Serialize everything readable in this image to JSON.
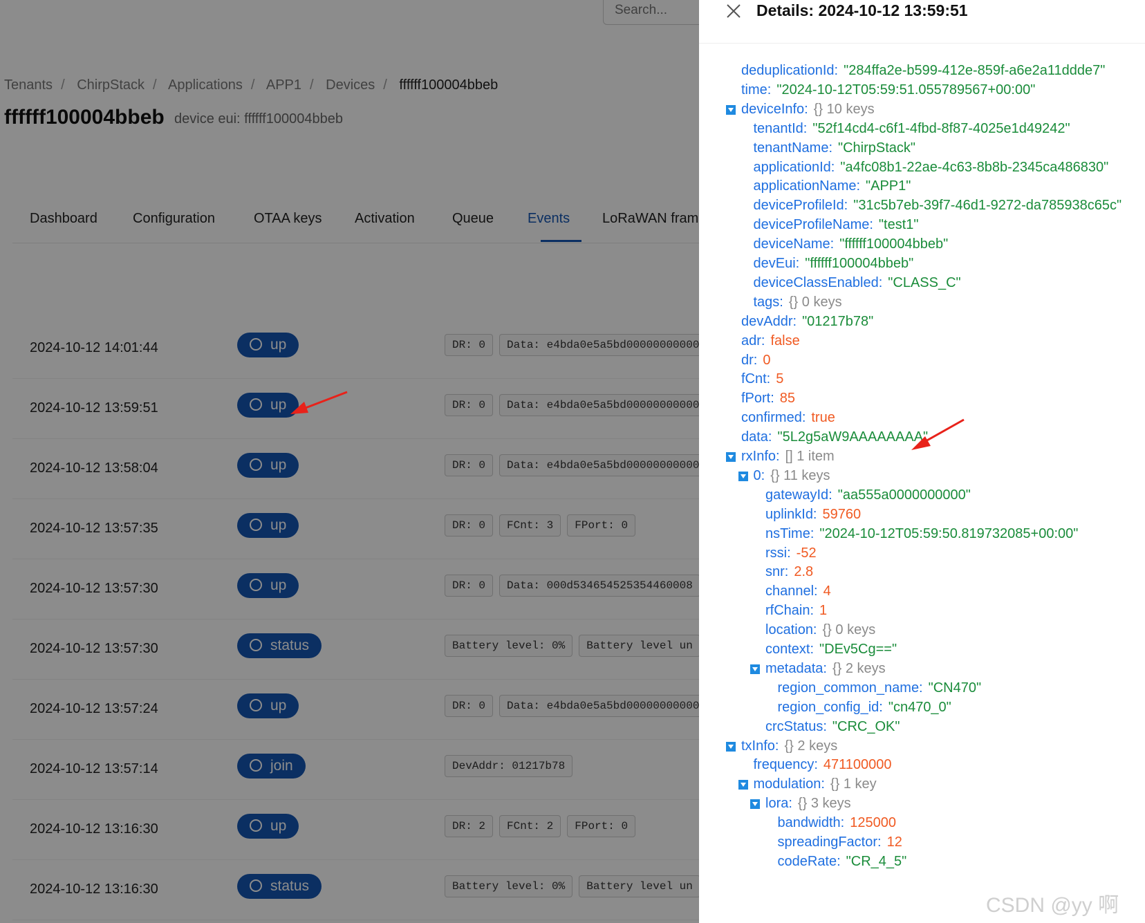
{
  "header": {
    "search_placeholder": "Search..."
  },
  "breadcrumb": [
    "Tenants",
    "ChirpStack",
    "Applications",
    "APP1",
    "Devices",
    "ffffff100004bbeb"
  ],
  "breadcrumb_sep": "/",
  "page_title": "ffffff100004bbeb",
  "page_subtitle": "device eui: ffffff100004bbeb",
  "tabs": [
    "Dashboard",
    "Configuration",
    "OTAA keys",
    "Activation",
    "Queue",
    "Events",
    "LoRaWAN fram"
  ],
  "active_tab": "Events",
  "events": [
    {
      "time": "2024-10-12 14:01:44",
      "type": "up",
      "tags": [
        "DR: 0",
        "Data: e4bda0e5a5bd00000000000"
      ]
    },
    {
      "time": "2024-10-12 13:59:51",
      "type": "up",
      "tags": [
        "DR: 0",
        "Data: e4bda0e5a5bd00000000000"
      ]
    },
    {
      "time": "2024-10-12 13:58:04",
      "type": "up",
      "tags": [
        "DR: 0",
        "Data: e4bda0e5a5bd00000000000"
      ]
    },
    {
      "time": "2024-10-12 13:57:35",
      "type": "up",
      "tags": [
        "DR: 0",
        "FCnt: 3",
        "FPort: 0"
      ]
    },
    {
      "time": "2024-10-12 13:57:30",
      "type": "up",
      "tags": [
        "DR: 0",
        "Data: 000d534654525354460008"
      ]
    },
    {
      "time": "2024-10-12 13:57:30",
      "type": "status",
      "tags": [
        "Battery level: 0%",
        "Battery level un"
      ]
    },
    {
      "time": "2024-10-12 13:57:24",
      "type": "up",
      "tags": [
        "DR: 0",
        "Data: e4bda0e5a5bd00000000000"
      ]
    },
    {
      "time": "2024-10-12 13:57:14",
      "type": "join",
      "tags": [
        "DevAddr: 01217b78"
      ]
    },
    {
      "time": "2024-10-12 13:16:30",
      "type": "up",
      "tags": [
        "DR: 2",
        "FCnt: 2",
        "FPort: 0"
      ]
    },
    {
      "time": "2024-10-12 13:16:30",
      "type": "status",
      "tags": [
        "Battery level: 0%",
        "Battery level un"
      ]
    }
  ],
  "drawer": {
    "title": "Details: 2024-10-12 13:59:51",
    "tree": [
      {
        "d": 0,
        "k": "deduplicationId:",
        "v": "\"284ffa2e-b599-412e-859f-a6e2a11ddde7\"",
        "t": "s"
      },
      {
        "d": 0,
        "k": "time:",
        "v": "\"2024-10-12T05:59:51.055789567+00:00\"",
        "t": "s"
      },
      {
        "d": 0,
        "k": "deviceInfo:",
        "v": "{}  10 keys",
        "t": "m",
        "tog": true
      },
      {
        "d": 1,
        "k": "tenantId:",
        "v": "\"52f14cd4-c6f1-4fbd-8f87-4025e1d49242\"",
        "t": "s"
      },
      {
        "d": 1,
        "k": "tenantName:",
        "v": "\"ChirpStack\"",
        "t": "s"
      },
      {
        "d": 1,
        "k": "applicationId:",
        "v": "\"a4fc08b1-22ae-4c63-8b8b-2345ca486830\"",
        "t": "s"
      },
      {
        "d": 1,
        "k": "applicationName:",
        "v": "\"APP1\"",
        "t": "s"
      },
      {
        "d": 1,
        "k": "deviceProfileId:",
        "v": "\"31c5b7eb-39f7-46d1-9272-da785938c65c\"",
        "t": "s"
      },
      {
        "d": 1,
        "k": "deviceProfileName:",
        "v": "\"test1\"",
        "t": "s"
      },
      {
        "d": 1,
        "k": "deviceName:",
        "v": "\"ffffff100004bbeb\"",
        "t": "s"
      },
      {
        "d": 1,
        "k": "devEui:",
        "v": "\"ffffff100004bbeb\"",
        "t": "s"
      },
      {
        "d": 1,
        "k": "deviceClassEnabled:",
        "v": "\"CLASS_C\"",
        "t": "s"
      },
      {
        "d": 1,
        "k": "tags:",
        "v": "{}  0 keys",
        "t": "m"
      },
      {
        "d": 0,
        "k": "devAddr:",
        "v": "\"01217b78\"",
        "t": "s"
      },
      {
        "d": 0,
        "k": "adr:",
        "v": "false",
        "t": "n"
      },
      {
        "d": 0,
        "k": "dr:",
        "v": "0",
        "t": "n"
      },
      {
        "d": 0,
        "k": "fCnt:",
        "v": "5",
        "t": "n"
      },
      {
        "d": 0,
        "k": "fPort:",
        "v": "85",
        "t": "n"
      },
      {
        "d": 0,
        "k": "confirmed:",
        "v": "true",
        "t": "n"
      },
      {
        "d": 0,
        "k": "data:",
        "v": "\"5L2g5aW9AAAAAAAA\"",
        "t": "s"
      },
      {
        "d": 0,
        "k": "rxInfo:",
        "v": "[]  1 item",
        "t": "m",
        "tog": true
      },
      {
        "d": 1,
        "k": "0:",
        "v": "{}  11 keys",
        "t": "m",
        "tog": true
      },
      {
        "d": 2,
        "k": "gatewayId:",
        "v": "\"aa555a0000000000\"",
        "t": "s"
      },
      {
        "d": 2,
        "k": "uplinkId:",
        "v": "59760",
        "t": "n"
      },
      {
        "d": 2,
        "k": "nsTime:",
        "v": "\"2024-10-12T05:59:50.819732085+00:00\"",
        "t": "s"
      },
      {
        "d": 2,
        "k": "rssi:",
        "v": "-52",
        "t": "n"
      },
      {
        "d": 2,
        "k": "snr:",
        "v": "2.8",
        "t": "n"
      },
      {
        "d": 2,
        "k": "channel:",
        "v": "4",
        "t": "n"
      },
      {
        "d": 2,
        "k": "rfChain:",
        "v": "1",
        "t": "n"
      },
      {
        "d": 2,
        "k": "location:",
        "v": "{}  0 keys",
        "t": "m"
      },
      {
        "d": 2,
        "k": "context:",
        "v": "\"DEv5Cg==\"",
        "t": "s"
      },
      {
        "d": 2,
        "k": "metadata:",
        "v": "{}  2 keys",
        "t": "m",
        "tog": true
      },
      {
        "d": 3,
        "k": "region_common_name:",
        "v": "\"CN470\"",
        "t": "s"
      },
      {
        "d": 3,
        "k": "region_config_id:",
        "v": "\"cn470_0\"",
        "t": "s"
      },
      {
        "d": 2,
        "k": "crcStatus:",
        "v": "\"CRC_OK\"",
        "t": "s"
      },
      {
        "d": 0,
        "k": "txInfo:",
        "v": "{}  2 keys",
        "t": "m",
        "tog": true
      },
      {
        "d": 1,
        "k": "frequency:",
        "v": "471100000",
        "t": "n"
      },
      {
        "d": 1,
        "k": "modulation:",
        "v": "{}  1 key",
        "t": "m",
        "tog": true
      },
      {
        "d": 2,
        "k": "lora:",
        "v": "{}  3 keys",
        "t": "m",
        "tog": true
      },
      {
        "d": 3,
        "k": "bandwidth:",
        "v": "125000",
        "t": "n"
      },
      {
        "d": 3,
        "k": "spreadingFactor:",
        "v": "12",
        "t": "n"
      },
      {
        "d": 3,
        "k": "codeRate:",
        "v": "\"CR_4_5\"",
        "t": "s"
      }
    ]
  },
  "watermark": "CSDN @yy 啊",
  "colors": {
    "accent": "#1556b3",
    "key": "#1f6fe0",
    "string": "#1a8c3a",
    "number": "#f05a22",
    "meta": "#8a8a8a",
    "toggle": "#1f8ae0"
  },
  "icons": {
    "close": "close-icon",
    "event_button": "zoom-in-icon",
    "toggle": "caret-down-icon"
  }
}
